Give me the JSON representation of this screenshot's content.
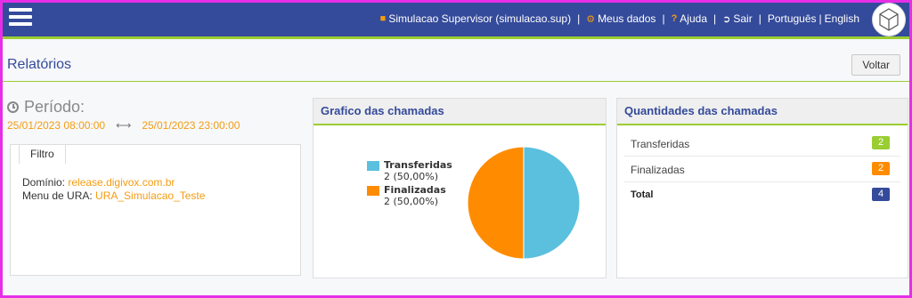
{
  "topbar": {
    "user_label": "Simulacao Supervisor (simulacao.sup)",
    "my_data_label": "Meus dados",
    "help_label": "Ajuda",
    "logout_label": "Sair",
    "lang_pt": "Português",
    "lang_en": "English",
    "separator": "|"
  },
  "header": {
    "title": "Relatórios",
    "back_label": "Voltar"
  },
  "period": {
    "title": "Período:",
    "start": "25/01/2023 08:00:00",
    "arrow": "⟷",
    "end": "25/01/2023 23:00:00"
  },
  "filter": {
    "tab_label": "Filtro",
    "domain_label": "Domínio:",
    "domain_value": "release.digivox.com.br",
    "menu_label": "Menu de URA:",
    "menu_value": "URA_Simulacao_Teste"
  },
  "chart_panel": {
    "title": "Grafico das chamadas"
  },
  "chart_data": {
    "type": "pie",
    "categories": [
      "Transferidas",
      "Finalizadas"
    ],
    "values": [
      2,
      2
    ],
    "percent_labels": [
      "2 (50,00%)",
      "2 (50,00%)"
    ],
    "colors": [
      "#5bc0de",
      "#ff8c00"
    ],
    "legend_placement": "left"
  },
  "qty_panel": {
    "title": "Quantidades das chamadas",
    "rows": [
      {
        "label": "Transferidas",
        "count": "2",
        "color": "#9acd32"
      },
      {
        "label": "Finalizadas",
        "count": "2",
        "color": "#ff8c00"
      },
      {
        "label": "Total",
        "count": "4",
        "color": "#344a9a"
      }
    ]
  },
  "colors": {
    "accent": "#344a9a",
    "highlight": "#9acd32",
    "orange": "#f39c12",
    "frame": "#e62ee6"
  }
}
